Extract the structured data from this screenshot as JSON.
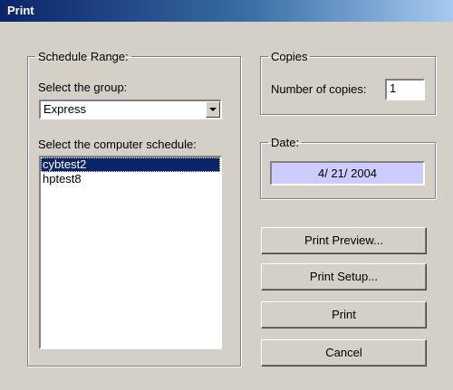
{
  "window": {
    "title": "Print"
  },
  "schedule_range": {
    "legend": "Schedule Range:",
    "group_label": "Select the group:",
    "group_value": "Express",
    "schedule_label": "Select the computer schedule:",
    "schedules": [
      "cybtest2",
      "hptest8"
    ],
    "selected_index": 0
  },
  "copies": {
    "legend": "Copies",
    "label": "Number of copies:",
    "value": "1"
  },
  "date": {
    "legend": "Date:",
    "value": "4/ 21/ 2004"
  },
  "buttons": {
    "print_preview": "Print Preview...",
    "print_setup": "Print Setup...",
    "print": "Print",
    "cancel": "Cancel"
  },
  "colors": {
    "title_bar": "#0a246a",
    "dialog_bg": "#d4d0c8",
    "date_field_bg": "#ccccff",
    "selection": "#0a246a"
  }
}
